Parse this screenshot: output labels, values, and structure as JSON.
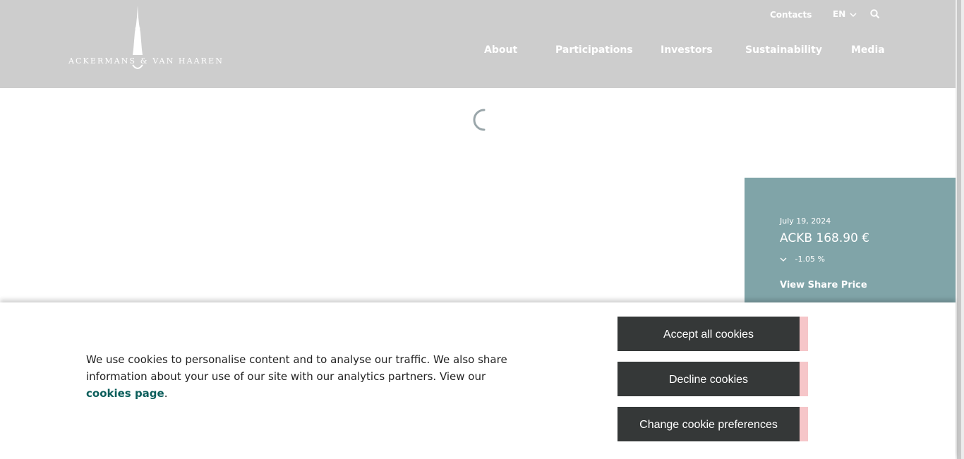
{
  "header": {
    "logo_text": "ACKERMANS & VAN HAAREN",
    "contacts": "Contacts",
    "language": "EN",
    "nav": [
      "About",
      "Participations",
      "Investors",
      "Sustainability",
      "Media"
    ]
  },
  "share": {
    "date": "July 19, 2024",
    "price": "ACKB 168.90 €",
    "change": "-1.05 %",
    "link": "View Share Price"
  },
  "cookie": {
    "text": "We use cookies to personalise content and to analyse our traffic. We also share information about your use of our site with our analytics partners. View our ",
    "link": "cookies page",
    "end": ".",
    "accept": "Accept all cookies",
    "decline": "Decline cookies",
    "preferences": "Change cookie preferences"
  },
  "colors": {
    "header_bg": "#cdcdcd",
    "share_bg": "#80a4a8",
    "button_bg": "#353838",
    "button_accent": "#f6c6c9",
    "link": "#0b5e5b"
  }
}
